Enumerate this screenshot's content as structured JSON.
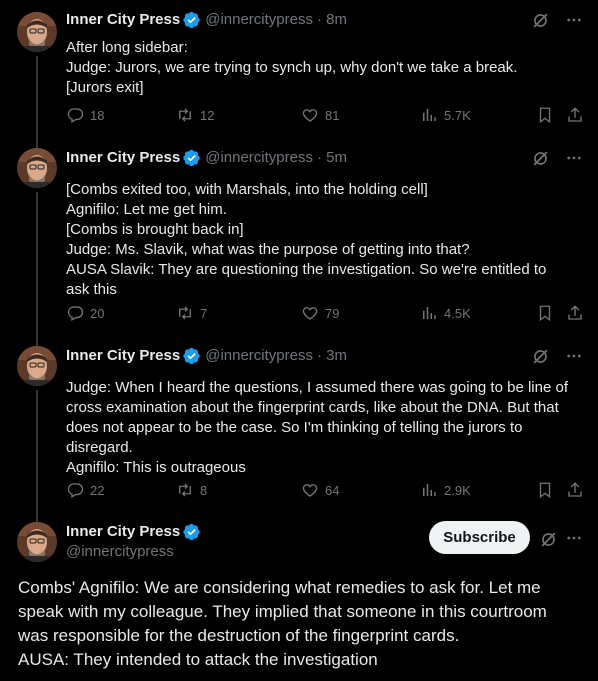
{
  "accent": "#1d9bf0",
  "tweets": [
    {
      "name": "Inner City Press",
      "handle": "@innercitypress",
      "time": "· 8m",
      "lines": [
        "After long sidebar:",
        "Judge: Jurors, we are trying to synch up, why don't we take a break.",
        "[Jurors exit]"
      ],
      "replies": "18",
      "reposts": "12",
      "likes": "81",
      "views": "5.7K"
    },
    {
      "name": "Inner City Press",
      "handle": "@innercitypress",
      "time": "· 5m",
      "lines": [
        "[Combs exited too, with Marshals, into the holding cell]",
        "Agnifilo: Let me get him.",
        "[Combs is brought back in]",
        "Judge: Ms. Slavik, what was the purpose of getting into that?",
        "AUSA Slavik: They are questioning the investigation. So we're entitled to",
        "ask this"
      ],
      "replies": "20",
      "reposts": "7",
      "likes": "79",
      "views": "4.5K"
    },
    {
      "name": "Inner City Press",
      "handle": "@innercitypress",
      "time": "· 3m",
      "lines": [
        "Judge: When I heard the questions, I assumed there was going to be line of",
        "cross examination about the fingerprint cards, like about the DNA. But that",
        "does not appear to be the case. So I'm thinking of telling the jurors to",
        "disregard.",
        "Agnifilo: This is outrageous"
      ],
      "replies": "22",
      "reposts": "8",
      "likes": "64",
      "views": "2.9K"
    }
  ],
  "main": {
    "name": "Inner City Press",
    "handle": "@innercitypress",
    "subscribe_label": "Subscribe",
    "lines": [
      "Combs' Agnifilo: We are considering what remedies to ask for. Let me",
      "speak with my colleague. They implied that someone in this courtroom",
      "was responsible for the destruction of the fingerprint cards.",
      "AUSA: They intended to attack the investigation"
    ]
  }
}
